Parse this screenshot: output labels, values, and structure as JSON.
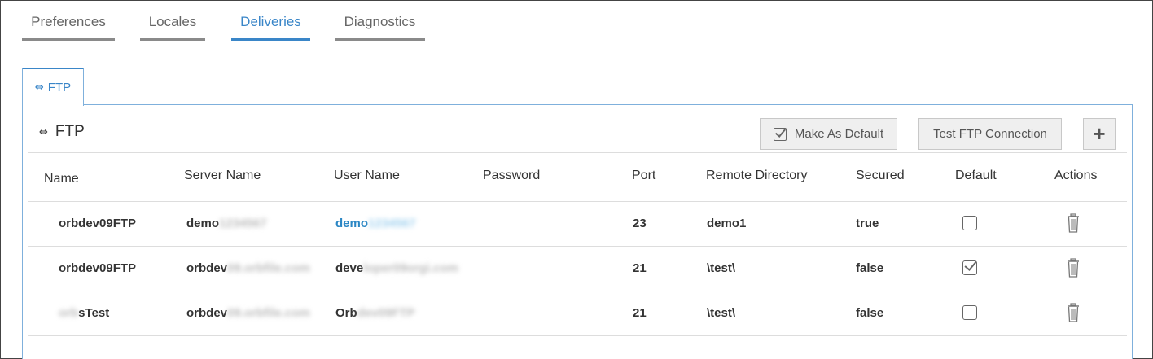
{
  "top_tabs": [
    {
      "label": "Preferences",
      "active": false
    },
    {
      "label": "Locales",
      "active": false
    },
    {
      "label": "Deliveries",
      "active": true
    },
    {
      "label": "Diagnostics",
      "active": false
    }
  ],
  "inner_tab": {
    "label": "FTP",
    "icon": "ftp-icon"
  },
  "panel": {
    "title": "FTP",
    "make_default_label": "Make As Default",
    "test_connection_label": "Test FTP Connection",
    "add_label": "+"
  },
  "table": {
    "columns": [
      "Name",
      "Server Name",
      "User Name",
      "Password",
      "Port",
      "Remote Directory",
      "Secured",
      "Default",
      "Actions"
    ],
    "rows": [
      {
        "name": "orbdev09FTP",
        "name_prefix": "",
        "server": "demo",
        "server_blur": "1234567",
        "user": "demo",
        "user_blur": "1234567",
        "password": "",
        "port": "23",
        "remote_dir": "demo1",
        "secured": "true",
        "default": false
      },
      {
        "name": "orbdev09FTP",
        "name_prefix": "",
        "server": "orbdev",
        "server_blur": "09.orbfile.com",
        "user": "deve",
        "user_blur": "loper09orgi.com",
        "password": "",
        "port": "21",
        "remote_dir": "\\test\\",
        "secured": "false",
        "default": true
      },
      {
        "name": "sTest",
        "name_prefix": "orb",
        "server": "orbdev",
        "server_blur": "09.orbfile.com",
        "user": "Orb",
        "user_blur": "dev09FTP",
        "password": "",
        "port": "21",
        "remote_dir": "\\test\\",
        "secured": "false",
        "default": false
      }
    ]
  },
  "colors": {
    "accent": "#3a86c8",
    "link": "#2a86c4"
  }
}
